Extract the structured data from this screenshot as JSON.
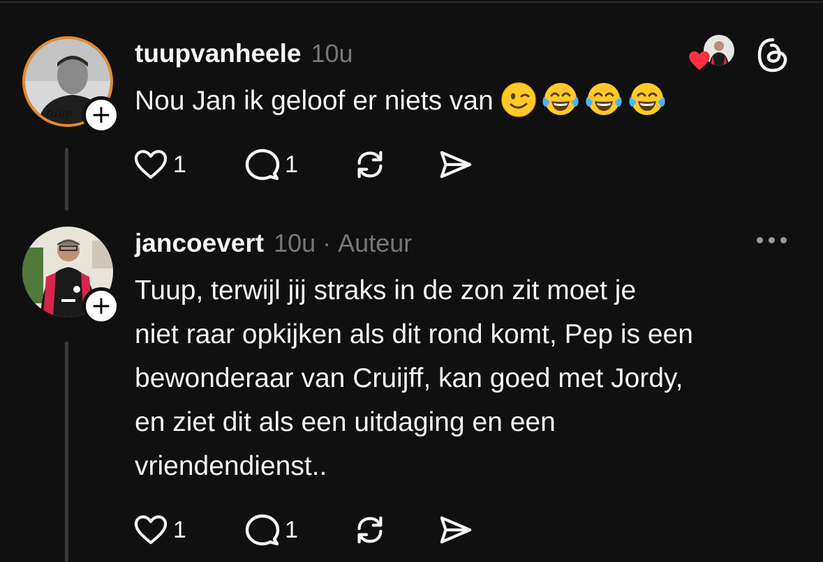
{
  "colors": {
    "background": "#101010",
    "text": "#f3f5f7",
    "meta": "#777777",
    "thread_line": "#3a3a3a",
    "like_heart": "#ff3040",
    "avatar_ring": "#e5892c"
  },
  "header_right": {
    "liked_icon": "red-heart-icon",
    "logo_icon": "threads-logo-icon"
  },
  "posts": [
    {
      "username": "tuupvanheele",
      "time": "10u",
      "text": "Nou Jan ik geloof er niets van",
      "emojis": [
        "winking-face-emoji",
        "face-with-tears-of-joy-emoji",
        "face-with-tears-of-joy-emoji",
        "face-with-tears-of-joy-emoji"
      ],
      "avatar_text": "tuup",
      "likes": "1",
      "replies": "1"
    },
    {
      "username": "jancoevert",
      "time": "10u",
      "separator": "·",
      "author_label": "Auteur",
      "lines": [
        "Tuup,  terwijl jij straks in de zon zit moet je",
        "niet raar opkijken als dit rond komt, Pep is een",
        "bewonderaar  van Cruijff, kan goed met Jordy,",
        "en ziet dit als een uitdaging en een",
        "vriendendienst.."
      ],
      "likes": "1",
      "replies": "1"
    }
  ],
  "follow_symbol": "+"
}
